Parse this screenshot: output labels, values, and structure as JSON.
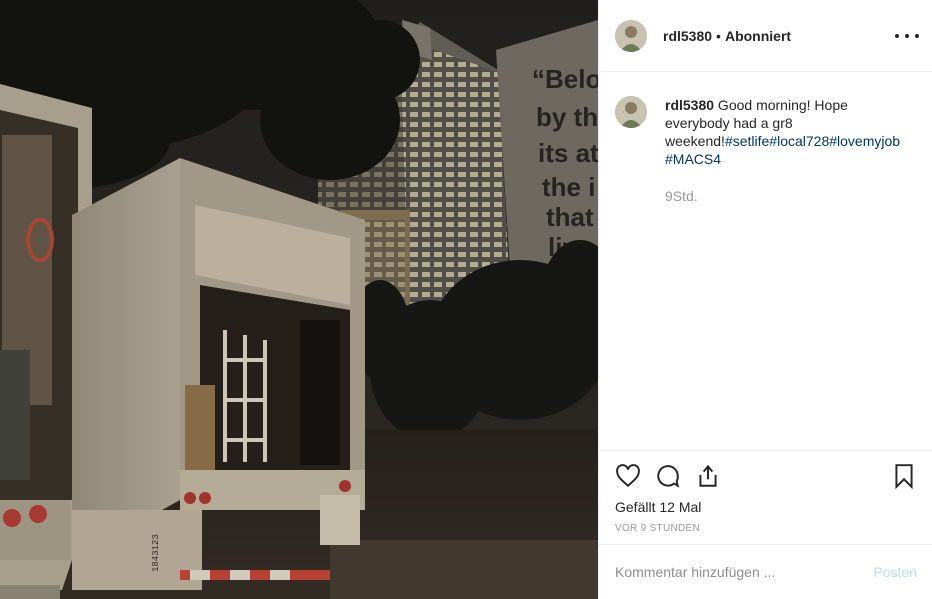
{
  "post": {
    "username": "rdl5380",
    "follow_status": "Abonniert",
    "separator": "•",
    "more_label": "Weitere Optionen"
  },
  "caption": {
    "username": "rdl5380",
    "text": " Good morning! Hope everybody had a gr8 weekend!",
    "hashtags": [
      "#setlife",
      "#local728",
      "#lovemyjob",
      "#MACS4"
    ],
    "time_relative": "9Std."
  },
  "engagement": {
    "likes_text": "Gefällt 12 Mal",
    "posted_time": "VOR 9 STUNDEN"
  },
  "comment_input": {
    "placeholder": "Kommentar hinzufügen ...",
    "post_label": "Posten"
  },
  "photo": {
    "wall_text_lines": [
      "“Belo",
      "by th",
      "its at",
      "the i",
      "that",
      "live"
    ],
    "truck_plate": "1843123"
  },
  "icons": {
    "like": "heart-icon",
    "comment": "comment-bubble-icon",
    "share": "share-icon",
    "save": "bookmark-icon",
    "more": "more-dots-icon"
  },
  "colors": {
    "hashtag": "#003569",
    "muted": "#999999",
    "post_button": "#b2dffc",
    "divider": "#efefef"
  }
}
